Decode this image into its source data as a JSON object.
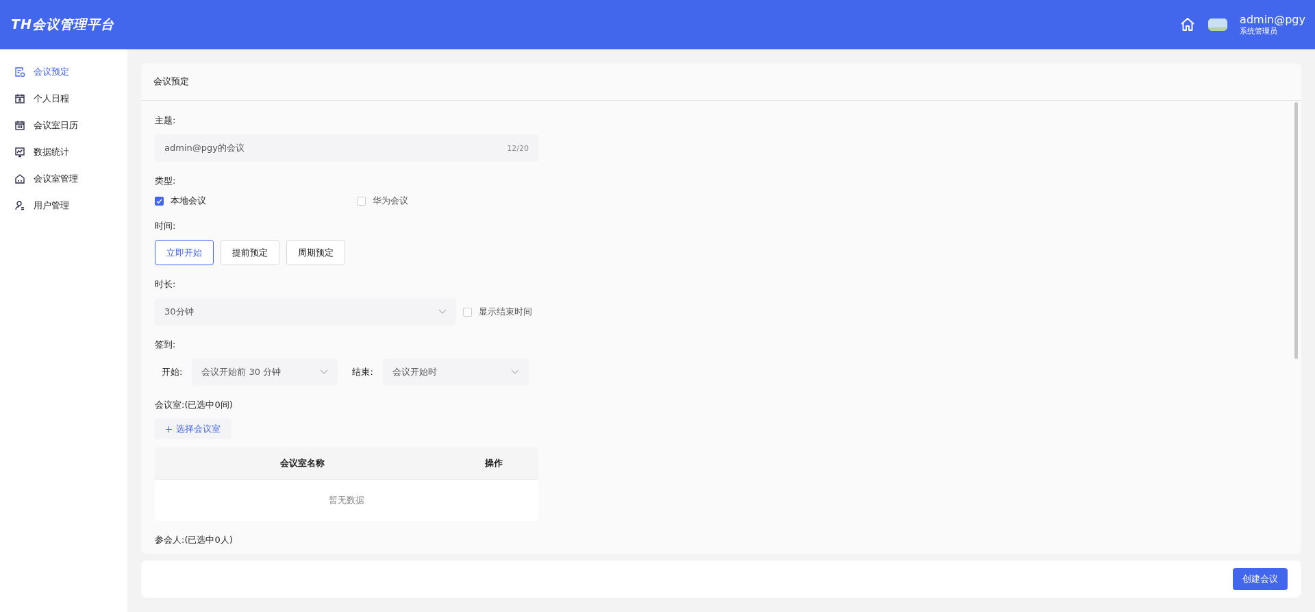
{
  "header": {
    "logo": "TH会议管理平台",
    "user_name": "admin@pgy",
    "user_role": "系统管理员"
  },
  "sidebar": {
    "items": [
      {
        "label": "会议预定",
        "selected": true
      },
      {
        "label": "个人日程",
        "selected": false
      },
      {
        "label": "会议室日历",
        "selected": false
      },
      {
        "label": "数据统计",
        "selected": false
      },
      {
        "label": "会议室管理",
        "selected": false
      },
      {
        "label": "用户管理",
        "selected": false
      }
    ]
  },
  "card": {
    "title": "会议预定"
  },
  "form": {
    "subject": {
      "label": "主题:",
      "value": "admin@pgy的会议",
      "count": "12/20"
    },
    "type": {
      "label": "类型:",
      "options": [
        {
          "label": "本地会议",
          "checked": true
        },
        {
          "label": "华为会议",
          "checked": false
        }
      ]
    },
    "time": {
      "label": "时间:",
      "options": [
        {
          "label": "立即开始",
          "selected": true
        },
        {
          "label": "提前预定",
          "selected": false
        },
        {
          "label": "周期预定",
          "selected": false
        }
      ]
    },
    "duration": {
      "label": "时长:",
      "value": "30分钟",
      "show_end": {
        "label": "显示结束时间",
        "checked": false
      }
    },
    "checkin": {
      "label": "签到:",
      "start_label": "开始:",
      "start_value": "会议开始前 30 分钟",
      "end_label": "结束:",
      "end_value": "会议开始时"
    },
    "rooms": {
      "label": "会议室:(已选中0间)",
      "add_button": "选择会议室",
      "columns": [
        "会议室名称",
        "操作"
      ],
      "empty": "暂无数据"
    },
    "participants": {
      "label": "参会人:(已选中0人)"
    }
  },
  "footer": {
    "submit": "创建会议"
  }
}
